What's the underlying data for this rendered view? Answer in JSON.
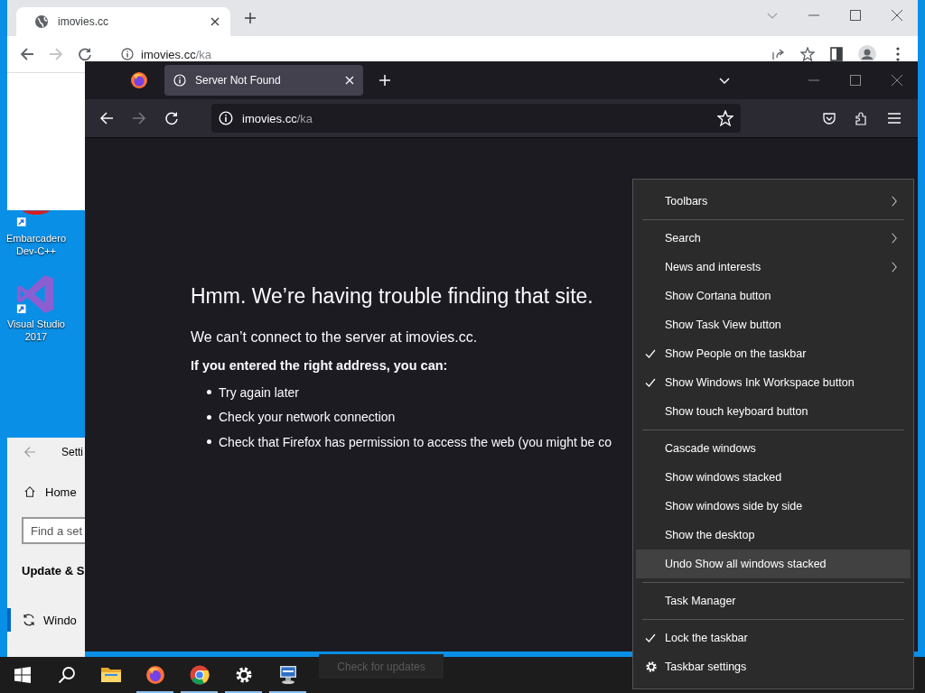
{
  "desktop_icons": [
    {
      "kind": "devcpp",
      "label": "Embarcadero Dev-C++"
    },
    {
      "kind": "visual-studio",
      "label": "Visual Studio 2017"
    }
  ],
  "chrome_window": {
    "tab_title": "imovies.cc",
    "address_host": "imovies.cc",
    "address_path": "/ka"
  },
  "settings_window": {
    "title": "Setti",
    "home": "Home",
    "search": {
      "placeholder": "Find a set"
    },
    "section": "Update & S",
    "item": "Windo"
  },
  "firefox_window": {
    "tab_title": "Server Not Found",
    "address_host": "imovies.cc",
    "address_path": "/ka",
    "error": {
      "title": "Hmm. We’re having trouble finding that site.",
      "message": "We can’t connect to the server at imovies.cc.",
      "hint": "If you entered the right address, you can:",
      "suggestions": [
        "Try again later",
        "Check your network connection",
        "Check that Firefox has permission to access the web (you might be co"
      ]
    }
  },
  "context_menu": {
    "items": [
      {
        "kind": "item",
        "label": "Toolbars",
        "checked": false,
        "submenu": true,
        "selected": false
      },
      {
        "kind": "separator"
      },
      {
        "kind": "item",
        "label": "Search",
        "checked": false,
        "submenu": true,
        "selected": false
      },
      {
        "kind": "item",
        "label": "News and interests",
        "checked": false,
        "submenu": true,
        "selected": false
      },
      {
        "kind": "item",
        "label": "Show Cortana button",
        "checked": false,
        "submenu": false,
        "selected": false
      },
      {
        "kind": "item",
        "label": "Show Task View button",
        "checked": false,
        "submenu": false,
        "selected": false
      },
      {
        "kind": "item",
        "label": "Show People on the taskbar",
        "checked": true,
        "submenu": false,
        "selected": false
      },
      {
        "kind": "item",
        "label": "Show Windows Ink Workspace button",
        "checked": true,
        "submenu": false,
        "selected": false
      },
      {
        "kind": "item",
        "label": "Show touch keyboard button",
        "checked": false,
        "submenu": false,
        "selected": false
      },
      {
        "kind": "separator"
      },
      {
        "kind": "item",
        "label": "Cascade windows",
        "checked": false,
        "submenu": false,
        "selected": false
      },
      {
        "kind": "item",
        "label": "Show windows stacked",
        "checked": false,
        "submenu": false,
        "selected": false
      },
      {
        "kind": "item",
        "label": "Show windows side by side",
        "checked": false,
        "submenu": false,
        "selected": false
      },
      {
        "kind": "item",
        "label": "Show the desktop",
        "checked": false,
        "submenu": false,
        "selected": false
      },
      {
        "kind": "item",
        "label": "Undo Show all windows stacked",
        "checked": false,
        "submenu": false,
        "selected": true
      },
      {
        "kind": "separator"
      },
      {
        "kind": "item",
        "label": "Task Manager",
        "checked": false,
        "submenu": false,
        "selected": false
      },
      {
        "kind": "separator"
      },
      {
        "kind": "item",
        "label": "Lock the taskbar",
        "checked": true,
        "submenu": false,
        "selected": false
      },
      {
        "kind": "settings",
        "label": "Taskbar settings",
        "checked": false,
        "submenu": false,
        "selected": false
      }
    ]
  },
  "taskbar": {
    "apps": [
      {
        "kind": "explorer",
        "running": false
      },
      {
        "kind": "firefox",
        "running": true
      },
      {
        "kind": "chrome",
        "running": true
      },
      {
        "kind": "settings",
        "running": true
      },
      {
        "kind": "computer",
        "running": true
      }
    ],
    "tooltip": "Check for updates"
  }
}
